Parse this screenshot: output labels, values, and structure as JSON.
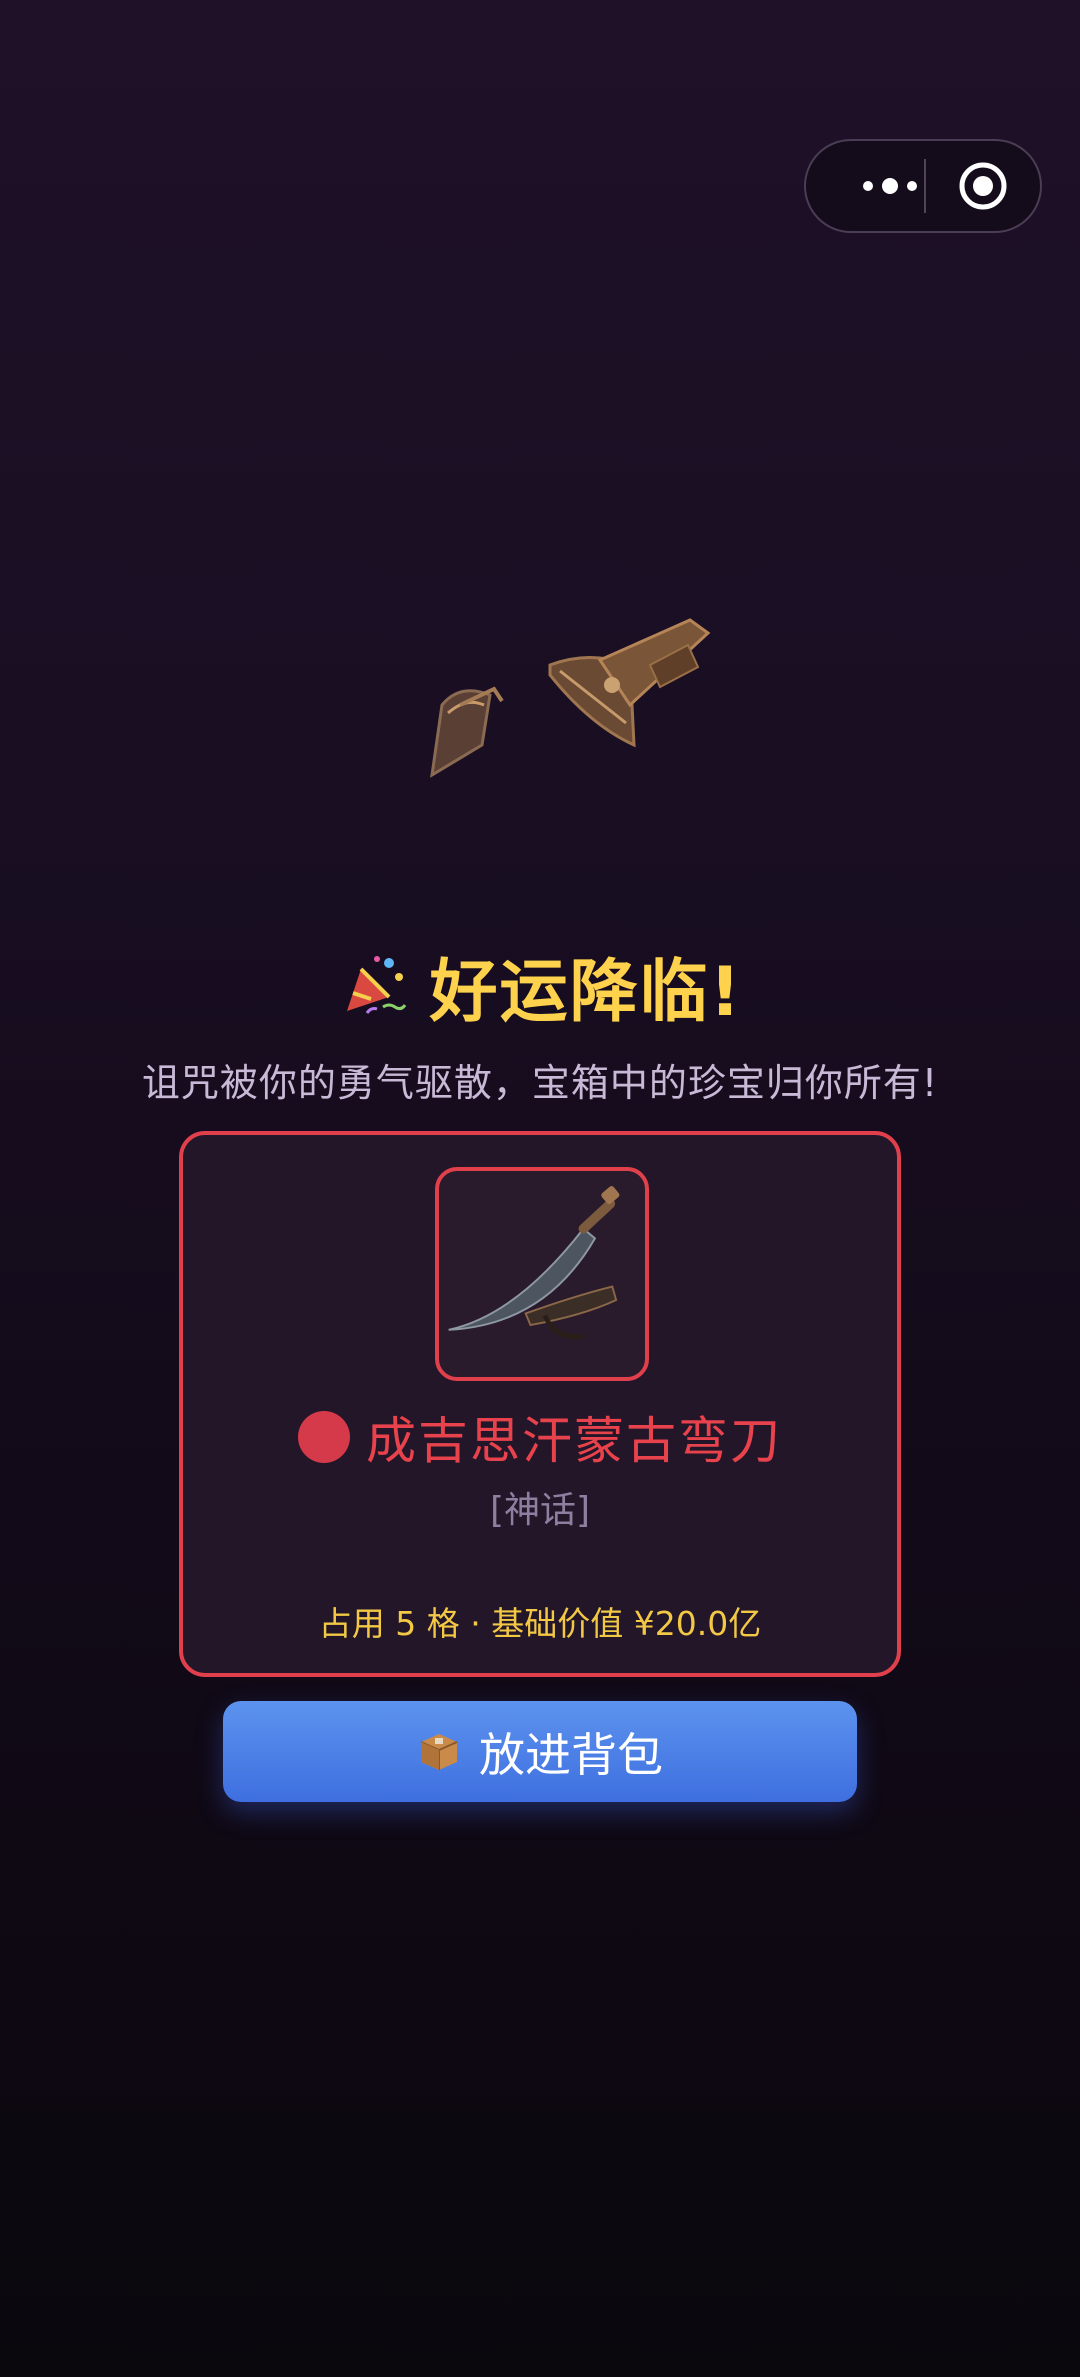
{
  "capsule": {
    "more_icon": "more-dots-icon",
    "close_icon": "target-circle-icon"
  },
  "header": {
    "emoji_icon": "party-popper-icon",
    "title": "好运降临!",
    "subtitle": "诅咒被你的勇气驱散，宝箱中的珍宝归你所有!"
  },
  "reward": {
    "image_icon": "curved-sabre-icon",
    "rarity_color": "#d43a4a",
    "name": "成吉思汗蒙古弯刀",
    "tier": "[神话]",
    "meta": "占用 5 格 · 基础价值 ¥20.0亿"
  },
  "actions": {
    "bag_icon": "package-icon",
    "bag_label": "放进背包"
  },
  "colors": {
    "accent_red": "#e0404b",
    "title_gold": "#ffd24d",
    "button_blue": "#4a7fe6"
  }
}
